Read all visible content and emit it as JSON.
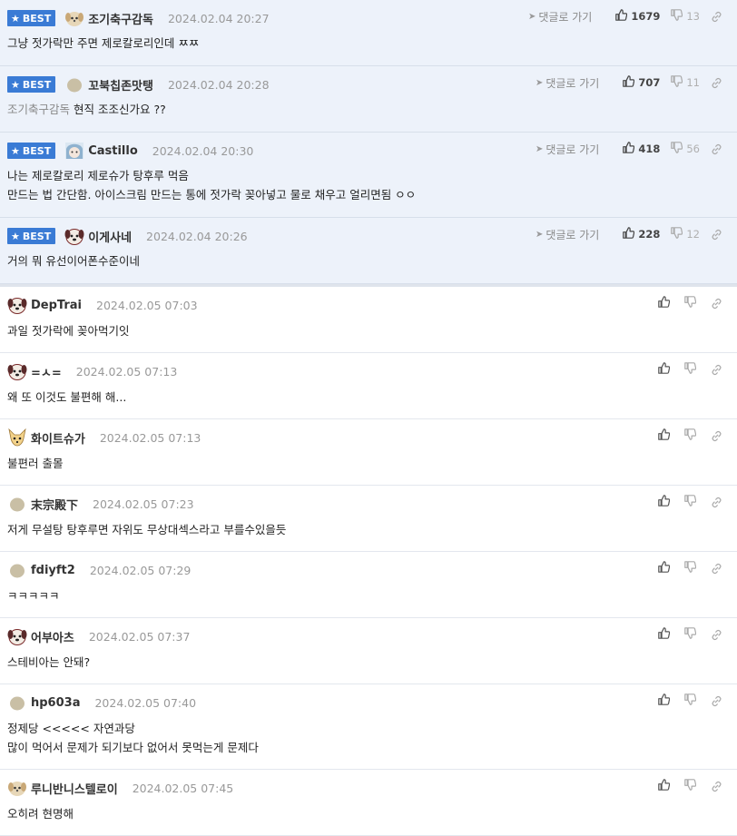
{
  "labels": {
    "best": "BEST",
    "goto": "댓글로 가기"
  },
  "best_comments": [
    {
      "nick": "조기축구감독",
      "date": "2024.02.04 20:27",
      "avatar": "puppy-avatar-icon",
      "up": "1679",
      "down": "13",
      "lines": [
        "그냥 젓가락만 주면 제로칼로리인데 ㅉㅉ"
      ]
    },
    {
      "nick": "꼬북칩존맛탱",
      "date": "2024.02.04 20:28",
      "avatar": "blob-avatar-icon",
      "up": "707",
      "down": "11",
      "mention": "조기축구감독",
      "lines": [
        "현직 조조신가요 ??"
      ]
    },
    {
      "nick": "Castillo",
      "date": "2024.02.04 20:30",
      "avatar": "anime-avatar-icon",
      "up": "418",
      "down": "56",
      "lines": [
        "나는 제로칼로리 제로슈가 탕후루 먹음",
        "만드는 법 간단함. 아이스크림 만드는 통에 젓가락 꽂아넣고 물로 채우고 얼리면됨 ㅇㅇ"
      ]
    },
    {
      "nick": "이게사네",
      "date": "2024.02.04 20:26",
      "avatar": "dog-avatar-icon",
      "up": "228",
      "down": "12",
      "lines": [
        "거의 뭐 유선이어폰수준이네"
      ]
    }
  ],
  "comments": [
    {
      "nick": "DepTrai",
      "date": "2024.02.05 07:03",
      "avatar": "dog-avatar-icon",
      "lines": [
        "과일 젓가락에 꽂아먹기잇"
      ]
    },
    {
      "nick": "=ㅅ=",
      "date": "2024.02.05 07:13",
      "avatar": "dog-avatar-icon",
      "lines": [
        "왜 또 이것도 불편해 해..."
      ]
    },
    {
      "nick": "화이트슈가",
      "date": "2024.02.05 07:13",
      "avatar": "fox-avatar-icon",
      "lines": [
        "불편러 출몰"
      ]
    },
    {
      "nick": "末宗殿下",
      "date": "2024.02.05 07:23",
      "avatar": "blob-avatar-icon",
      "lines": [
        "저게 무설탕 탕후루면 자위도 무상대섹스라고 부를수있을듯"
      ]
    },
    {
      "nick": "fdiyft2",
      "date": "2024.02.05 07:29",
      "avatar": "blob-avatar-icon",
      "lines": [
        "ㅋㅋㅋㅋㅋ"
      ]
    },
    {
      "nick": "어부아츠",
      "date": "2024.02.05 07:37",
      "avatar": "dog-avatar-icon",
      "lines": [
        "스테비아는 안돼?"
      ]
    },
    {
      "nick": "hp603a",
      "date": "2024.02.05 07:40",
      "avatar": "blob-avatar-icon",
      "lines": [
        "정제당 <<<<< 자연과당",
        "많이 먹어서 문제가 되기보다 없어서 못먹는게 문제다"
      ]
    },
    {
      "nick": "루니반니스텔로이",
      "date": "2024.02.05 07:45",
      "avatar": "puppy-avatar-icon",
      "lines": [
        "오히려 현명해"
      ]
    }
  ]
}
